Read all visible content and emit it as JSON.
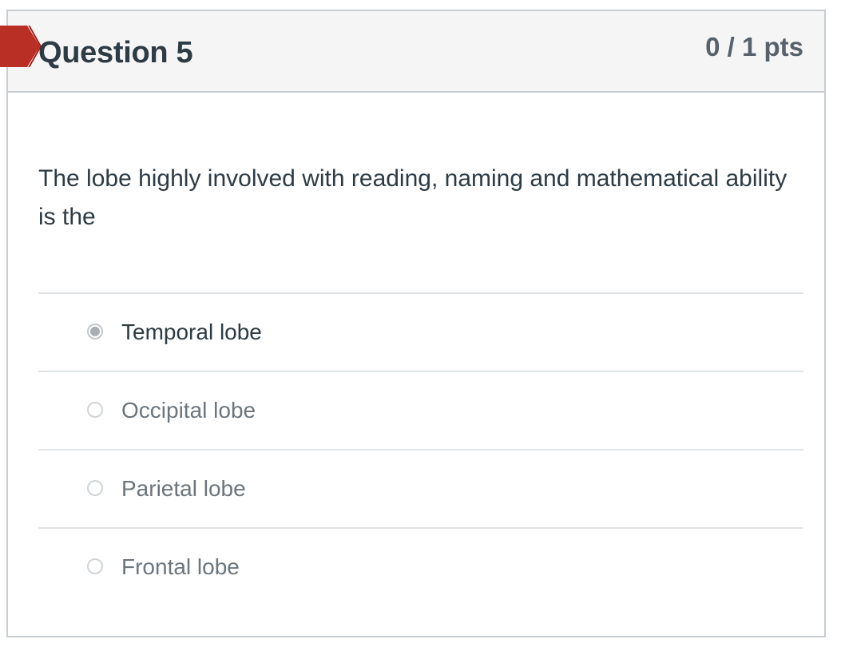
{
  "question": {
    "title": "Question 5",
    "points": "0 / 1 pts",
    "text": "The lobe highly involved with reading, naming and mathematical ability is the"
  },
  "answers": [
    {
      "label": "Temporal lobe",
      "selected": true
    },
    {
      "label": "Occipital lobe",
      "selected": false
    },
    {
      "label": "Parietal lobe",
      "selected": false
    },
    {
      "label": "Frontal lobe",
      "selected": false
    }
  ],
  "colors": {
    "flag": "#b92e25",
    "title": "#2d3b45",
    "points": "#56616b",
    "border": "#c7cdd1",
    "header_bg": "#f5f5f5"
  },
  "icons": {
    "flag": "incorrect-flag-icon",
    "radio": "radio-icon"
  }
}
